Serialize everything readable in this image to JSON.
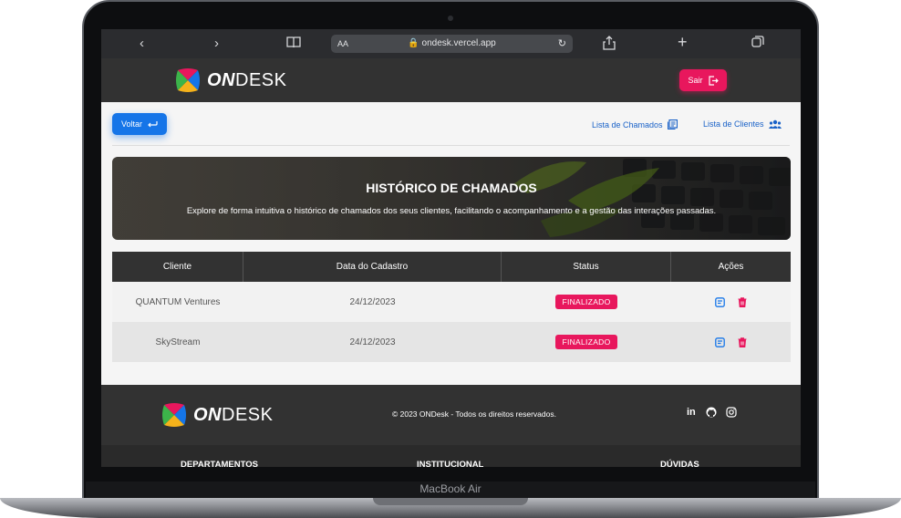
{
  "browser": {
    "url": "ondesk.vercel.app",
    "aa_label": "AA"
  },
  "header": {
    "logo_on": "ON",
    "logo_desk": "DESK",
    "logout_label": "Sair"
  },
  "nav": {
    "back_label": "Voltar",
    "links": [
      {
        "label": "Lista de Chamados"
      },
      {
        "label": "Lista de Clientes"
      }
    ]
  },
  "banner": {
    "title": "HISTÓRICO DE CHAMADOS",
    "subtitle": "Explore de forma intuitiva o histórico de chamados dos seus clientes, facilitando o acompanhamento e a gestão das interações passadas."
  },
  "table": {
    "columns": [
      "Cliente",
      "Data do Cadastro",
      "Status",
      "Ações"
    ],
    "rows": [
      {
        "cliente": "QUANTUM Ventures",
        "data": "24/12/2023",
        "status": "FINALIZADO"
      },
      {
        "cliente": "SkyStream",
        "data": "24/12/2023",
        "status": "FINALIZADO"
      }
    ]
  },
  "footer": {
    "logo_on": "ON",
    "logo_desk": "DESK",
    "copyright": "© 2023 ONDesk - Todos os direitos reservados.",
    "social": [
      "linkedin-icon",
      "github-icon",
      "instagram-icon"
    ],
    "sections": [
      "DEPARTAMENTOS",
      "INSTITUCIONAL",
      "DÚVIDAS"
    ]
  },
  "device": {
    "model": "MacBook Air"
  },
  "colors": {
    "accent_pink": "#e8175d",
    "accent_blue": "#1575e8",
    "dark": "#323232"
  }
}
